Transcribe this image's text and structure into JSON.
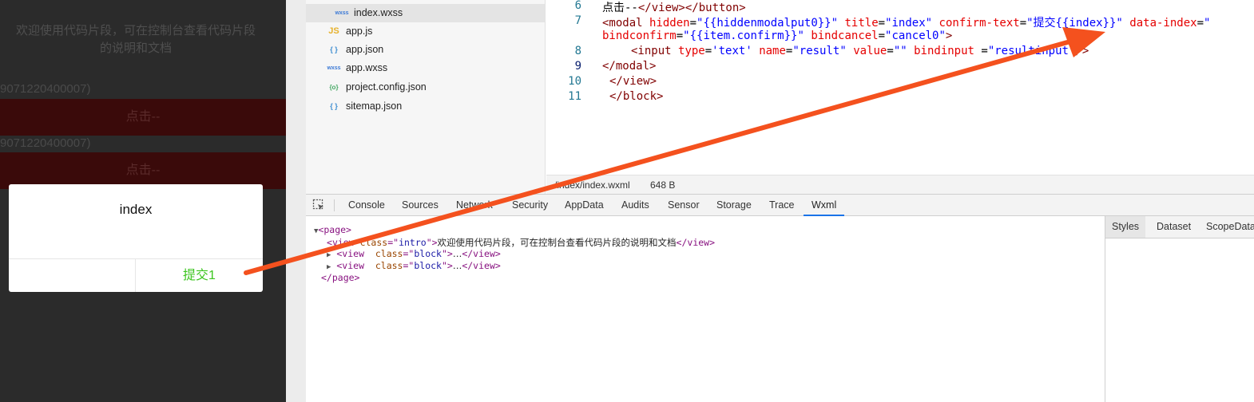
{
  "simulator": {
    "intro": "欢迎使用代码片段，可在控制台查看代码片段的说明和文档",
    "items": [
      {
        "id_text": "9071220400007)",
        "button_label": "点击--"
      },
      {
        "id_text": "9071220400007)",
        "button_label": "点击--"
      }
    ],
    "modal": {
      "title": "index",
      "confirm_label": "提交1",
      "cancel_label": ""
    }
  },
  "file_tree": {
    "items": [
      {
        "icon": "wxss",
        "name": "index.wxss"
      },
      {
        "icon": "JS",
        "name": "app.js"
      },
      {
        "icon": "{ }",
        "name": "app.json"
      },
      {
        "icon": "wxss",
        "name": "app.wxss"
      },
      {
        "icon": "{o}",
        "name": "project.config.json"
      },
      {
        "icon": "{ }",
        "name": "sitemap.json"
      }
    ]
  },
  "editor": {
    "line_numbers": [
      "6",
      "7",
      "8",
      "9",
      "10",
      "11"
    ],
    "line6": {
      "text": "点击--",
      "tail": "</view></button>"
    },
    "line7": {
      "open": "<modal",
      "a1": "hidden",
      "v1": "\"{{hiddenmodalput0}}\"",
      "a2": "title",
      "v2": "\"index\"",
      "a3": "confirm-text",
      "v3": "\"提交{{index}}\"",
      "a4": "data-index",
      "v4": "\"",
      "a5": "bindconfirm",
      "v5": "\"{{item.confirm}}\"",
      "a6": "bindcancel",
      "v6": "\"cancel0\"",
      "close": ">"
    },
    "line8": {
      "open": "<input",
      "a1": "type",
      "v1": "'text'",
      "a2": "name",
      "v2": "\"result\"",
      "a3": "value",
      "v3": "\"\"",
      "a4": "bindinput",
      "v4": "\"resultinput\"",
      "close": "/>"
    },
    "line9": "</modal>",
    "line10": "</view>",
    "line11": "</block>",
    "status_path": "/index/index.wxml",
    "status_size": "648 B"
  },
  "devtools": {
    "tabs": [
      "Console",
      "Sources",
      "Network",
      "Security",
      "AppData",
      "Audits",
      "Sensor",
      "Storage",
      "Trace",
      "Wxml"
    ],
    "active_tab": "Wxml",
    "side_tabs": [
      "Styles",
      "Dataset",
      "ScopeData"
    ],
    "dom": {
      "page_open": "<page>",
      "page_close": "</page>",
      "view_tag": "view",
      "class_attr": "class",
      "intro_class": "intro",
      "intro_text": "欢迎使用代码片段，可在控制台查看代码片段的说明和文档",
      "block_class": "block",
      "ellipsis": "…",
      "view_close": "</view>"
    }
  },
  "colors": {
    "annotation_arrow": "#f4511e",
    "confirm_text": "#3cc51f",
    "active_tab_underline": "#1a73e8"
  }
}
